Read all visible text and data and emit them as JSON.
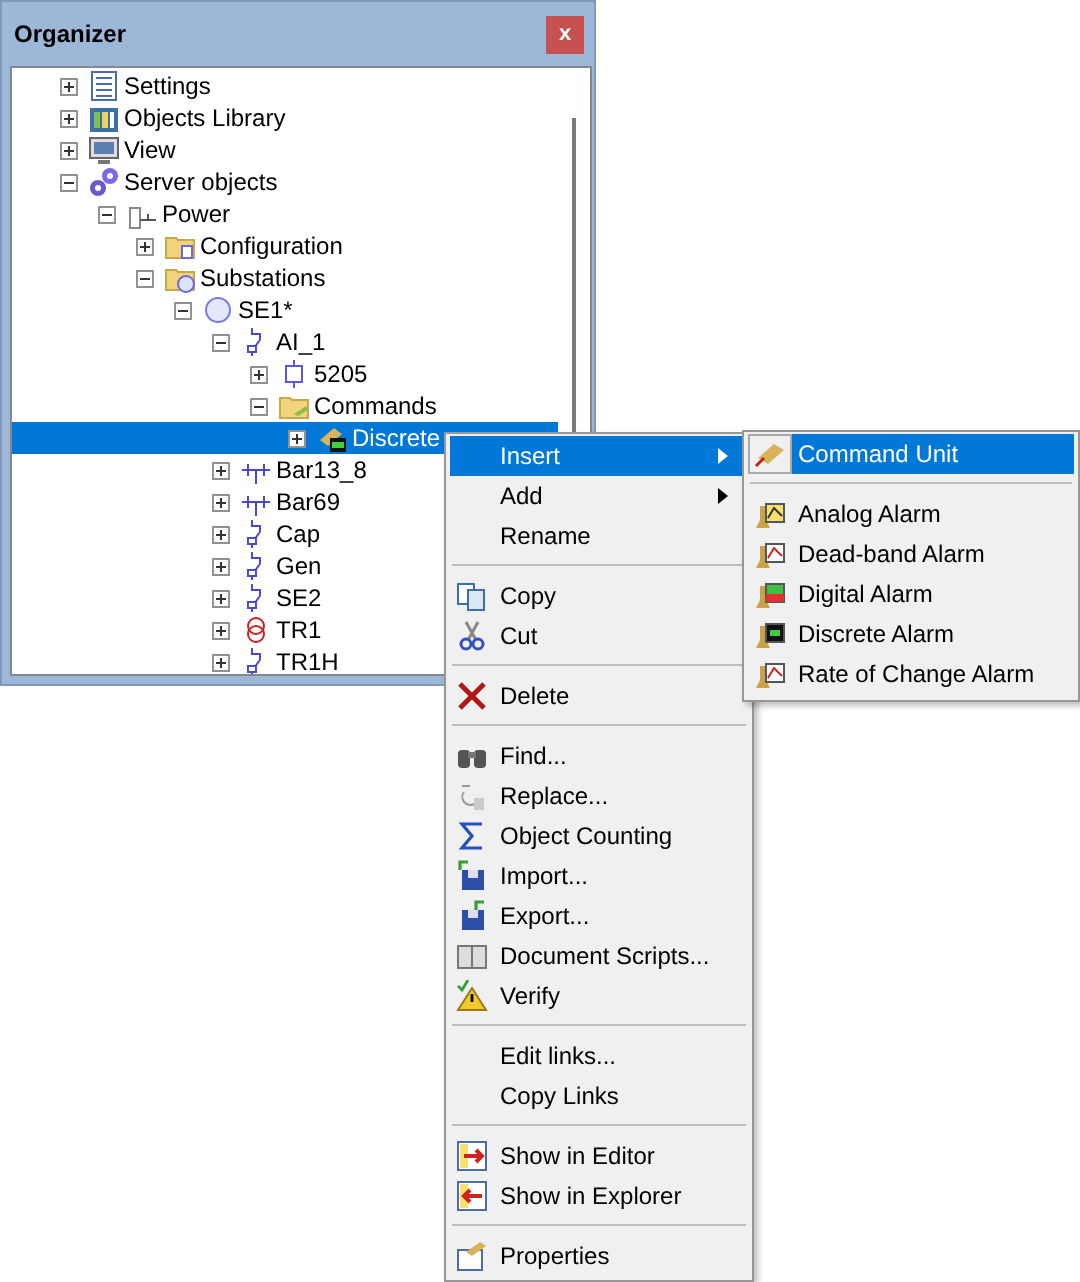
{
  "window": {
    "title": "Organizer",
    "close_label": "x"
  },
  "tree": [
    {
      "label": "Settings",
      "kind": "settings",
      "expanded": false,
      "selected": false
    },
    {
      "label": "Objects Library",
      "kind": "library",
      "expanded": false,
      "selected": false
    },
    {
      "label": "View",
      "kind": "view",
      "expanded": false,
      "selected": false
    },
    {
      "label": "Server objects",
      "kind": "server",
      "expanded": true,
      "selected": false,
      "children": [
        {
          "label": "Power",
          "kind": "power",
          "expanded": true,
          "selected": false,
          "children": [
            {
              "label": "Configuration",
              "kind": "config",
              "expanded": false,
              "selected": false
            },
            {
              "label": "Substations",
              "kind": "substations",
              "expanded": true,
              "selected": false,
              "children": [
                {
                  "label": "SE1*",
                  "kind": "substation",
                  "expanded": true,
                  "selected": false,
                  "children": [
                    {
                      "label": "AI_1",
                      "kind": "switch",
                      "expanded": true,
                      "selected": false,
                      "children": [
                        {
                          "label": "5205",
                          "kind": "unit",
                          "expanded": false,
                          "selected": false
                        },
                        {
                          "label": "Commands",
                          "kind": "commands",
                          "expanded": true,
                          "selected": false,
                          "children": [
                            {
                              "label": "Discrete",
                              "kind": "command",
                              "expanded": false,
                              "selected": true
                            }
                          ]
                        }
                      ]
                    },
                    {
                      "label": "Bar13_8",
                      "kind": "bus",
                      "expanded": false,
                      "selected": false
                    },
                    {
                      "label": "Bar69",
                      "kind": "bus",
                      "expanded": false,
                      "selected": false
                    },
                    {
                      "label": "Cap",
                      "kind": "switch",
                      "expanded": false,
                      "selected": false
                    },
                    {
                      "label": "Gen",
                      "kind": "switch",
                      "expanded": false,
                      "selected": false
                    },
                    {
                      "label": "SE2",
                      "kind": "switch",
                      "expanded": false,
                      "selected": false
                    },
                    {
                      "label": "TR1",
                      "kind": "transformer",
                      "expanded": false,
                      "selected": false
                    },
                    {
                      "label": "TR1H",
                      "kind": "switch",
                      "expanded": false,
                      "selected": false
                    }
                  ]
                }
              ]
            }
          ]
        }
      ]
    }
  ],
  "context_menu": [
    [
      {
        "label": "Insert",
        "has_submenu": true,
        "selected": true
      },
      {
        "label": "Add",
        "has_submenu": true,
        "selected": false
      },
      {
        "label": "Rename",
        "has_submenu": false,
        "selected": false
      }
    ],
    [
      {
        "label": "Copy",
        "has_submenu": false,
        "selected": false
      },
      {
        "label": "Cut",
        "has_submenu": false,
        "selected": false
      }
    ],
    [
      {
        "label": "Delete",
        "has_submenu": false,
        "selected": false
      }
    ],
    [
      {
        "label": "Find...",
        "has_submenu": false,
        "selected": false
      },
      {
        "label": "Replace...",
        "has_submenu": false,
        "selected": false
      },
      {
        "label": "Object Counting",
        "has_submenu": false,
        "selected": false
      },
      {
        "label": "Import...",
        "has_submenu": false,
        "selected": false
      },
      {
        "label": "Export...",
        "has_submenu": false,
        "selected": false
      },
      {
        "label": "Document Scripts...",
        "has_submenu": false,
        "selected": false
      },
      {
        "label": "Verify",
        "has_submenu": false,
        "selected": false
      }
    ],
    [
      {
        "label": "Edit links...",
        "has_submenu": false,
        "selected": false
      },
      {
        "label": "Copy Links",
        "has_submenu": false,
        "selected": false
      }
    ],
    [
      {
        "label": "Show in Editor",
        "has_submenu": false,
        "selected": false
      },
      {
        "label": "Show in Explorer",
        "has_submenu": false,
        "selected": false
      }
    ],
    [
      {
        "label": "Properties",
        "has_submenu": false,
        "selected": false
      }
    ]
  ],
  "submenu": [
    [
      {
        "label": "Command Unit",
        "selected": true
      }
    ],
    [
      {
        "label": "Analog Alarm",
        "selected": false
      },
      {
        "label": "Dead-band Alarm",
        "selected": false
      },
      {
        "label": "Digital Alarm",
        "selected": false
      },
      {
        "label": "Discrete Alarm",
        "selected": false
      },
      {
        "label": "Rate of Change Alarm",
        "selected": false
      }
    ]
  ]
}
